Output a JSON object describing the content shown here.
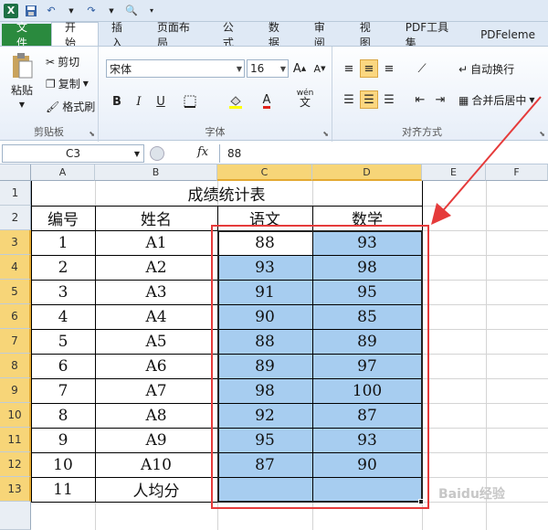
{
  "quick_access": {
    "icons": [
      "excel-logo-icon",
      "save-icon",
      "undo-icon",
      "redo-icon",
      "print-preview-icon",
      "customize-icon"
    ]
  },
  "tabs": [
    "文件",
    "开始",
    "插入",
    "页面布局",
    "公式",
    "数据",
    "审阅",
    "视图",
    "PDF工具集",
    "PDFeleme"
  ],
  "ribbon": {
    "clipboard": {
      "paste": "粘贴",
      "cut": "剪切",
      "copy": "复制",
      "format_painter": "格式刷",
      "label": "剪贴板"
    },
    "font": {
      "name": "宋体",
      "size": "16",
      "label": "字体",
      "bold": "B",
      "italic": "I",
      "underline": "U",
      "font_color": "A",
      "grow": "A",
      "shrink": "A",
      "wen": "wén",
      "wen_char": "文"
    },
    "alignment": {
      "wrap_text": "自动换行",
      "merge_center": "合并后居中",
      "label": "对齐方式"
    }
  },
  "formula_bar": {
    "cell_ref": "C3",
    "fx": "fx",
    "value": "88"
  },
  "columns": [
    "A",
    "B",
    "C",
    "D",
    "E",
    "F"
  ],
  "rows": [
    "1",
    "2",
    "3",
    "4",
    "5",
    "6",
    "7",
    "8",
    "9",
    "10",
    "11",
    "12",
    "13"
  ],
  "sheet": {
    "title": "成绩统计表",
    "headers": [
      "编号",
      "姓名",
      "语文",
      "数学"
    ],
    "data": [
      [
        "1",
        "A1",
        "88",
        "93"
      ],
      [
        "2",
        "A2",
        "93",
        "98"
      ],
      [
        "3",
        "A3",
        "91",
        "95"
      ],
      [
        "4",
        "A4",
        "90",
        "85"
      ],
      [
        "5",
        "A5",
        "88",
        "89"
      ],
      [
        "6",
        "A6",
        "89",
        "97"
      ],
      [
        "7",
        "A7",
        "98",
        "100"
      ],
      [
        "8",
        "A8",
        "92",
        "87"
      ],
      [
        "9",
        "A9",
        "95",
        "93"
      ],
      [
        "10",
        "A10",
        "87",
        "90"
      ],
      [
        "11",
        "人均分",
        "",
        ""
      ]
    ]
  },
  "watermark": "Baidu经验",
  "colors": {
    "selection": "#a7cdf0",
    "annotation": "#e53b3b",
    "header_selected": "#f7d578"
  }
}
